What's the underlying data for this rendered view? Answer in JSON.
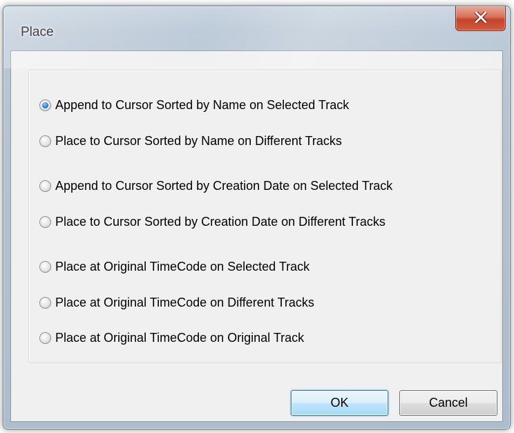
{
  "window": {
    "title": "Place"
  },
  "options": [
    {
      "label": "Append to Cursor Sorted by Name on Selected Track",
      "checked": true
    },
    {
      "label": "Place to Cursor Sorted by Name on Different Tracks",
      "checked": false
    },
    {
      "label": "Append to Cursor Sorted by Creation Date on Selected Track",
      "checked": false
    },
    {
      "label": "Place to Cursor Sorted by Creation Date on Different Tracks",
      "checked": false
    },
    {
      "label": "Place at Original TimeCode on Selected Track",
      "checked": false
    },
    {
      "label": "Place at Original TimeCode on Different Tracks",
      "checked": false
    },
    {
      "label": "Place at Original TimeCode on Original Track",
      "checked": false
    }
  ],
  "buttons": {
    "ok_label": "OK",
    "cancel_label": "Cancel"
  },
  "icons": {
    "close": "close-icon"
  }
}
